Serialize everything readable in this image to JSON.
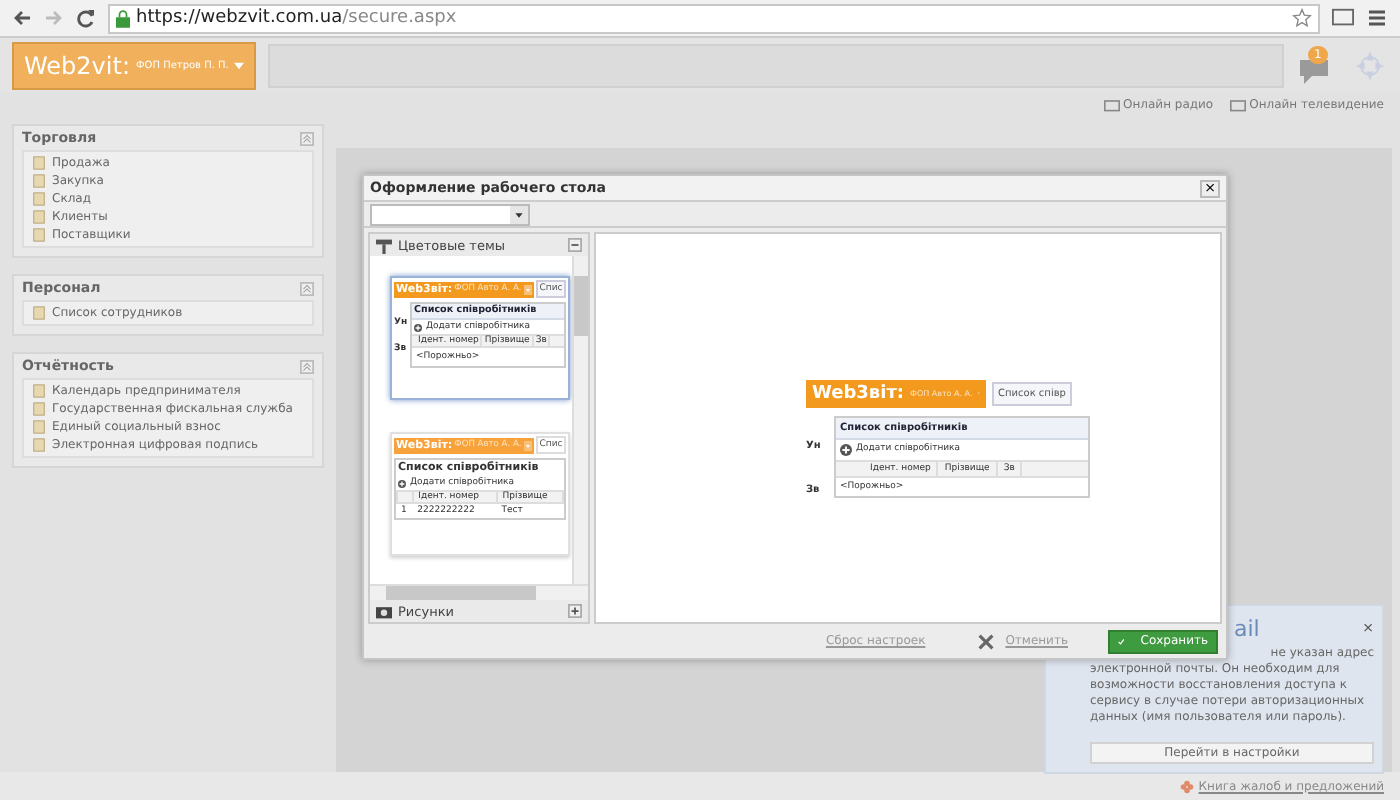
{
  "browser": {
    "url_host": "https://webzvit.com.ua",
    "url_path": "/secure.aspx"
  },
  "header": {
    "logo": "Web2vit:",
    "org": "ФОП Петров П. П.",
    "notifications": "1"
  },
  "top_links": [
    "Онлайн радио",
    "Онлайн телевидение"
  ],
  "sidebar": [
    {
      "title": "Торговля",
      "items": [
        "Продажа",
        "Закупка",
        "Склад",
        "Клиенты",
        "Поставщики"
      ]
    },
    {
      "title": "Персонал",
      "items": [
        "Список сотрудников"
      ]
    },
    {
      "title": "Отчётность",
      "items": [
        "Календарь предпринимателя",
        "Государственная фискальная служба",
        "Единый социальный взнос",
        "Электронная цифровая подпись"
      ]
    }
  ],
  "dialog": {
    "title": "Оформление рабочего стола",
    "close": "×",
    "sections": [
      {
        "title": "Цветовые темы",
        "expanded": true
      },
      {
        "title": "Рисунки",
        "expanded": false
      }
    ],
    "themes": [
      {
        "kind": "classic",
        "selected": true,
        "preview": {
          "logo": "Web3віт:",
          "org": "ФОП Авто А. А.",
          "tab": "Спис",
          "title": "Список співробітників",
          "add": "Додати співробітника",
          "columns": [
            "Ідент. номер",
            "Прізвище",
            "Зв"
          ],
          "empty": "<Порожньо>",
          "side_labels": [
            "Ун",
            "Зв"
          ]
        }
      },
      {
        "kind": "modern",
        "selected": false,
        "preview": {
          "logo": "Web3віт:",
          "org": "ФОП Авто А. А.",
          "tab": "Спис",
          "title": "Список співробітників",
          "add": "Додати співробітника",
          "columns": [
            "",
            "Ідент. номер",
            "Прізвище"
          ],
          "rows": [
            [
              "1",
              "2222222222",
              "Тест"
            ]
          ]
        }
      }
    ],
    "preview": {
      "kind": "classic",
      "logo": "Web3віт:",
      "org": "ФОП Авто А. А.",
      "tab": "Список співр",
      "title": "Список співробітників",
      "add": "Додати співробітника",
      "columns": [
        "Ідент. номер",
        "Прізвище",
        "Зв"
      ],
      "empty": "<Порожньо>",
      "side_labels": [
        "Ун",
        "Зв"
      ]
    },
    "reset": "Сброс настроек",
    "cancel": "Отменить",
    "save": "Сохранить"
  },
  "notification": {
    "title": "ail",
    "close": "×",
    "lines": [
      "не указан адрес",
      "электронной почты. Он необходим для",
      "возможности восстановления доступа к",
      "сервису в случае потери авторизационных",
      "данных (имя пользователя или пароль)."
    ],
    "button": "Перейти в настройки"
  },
  "footer_link": "Книга жалоб и предложений"
}
